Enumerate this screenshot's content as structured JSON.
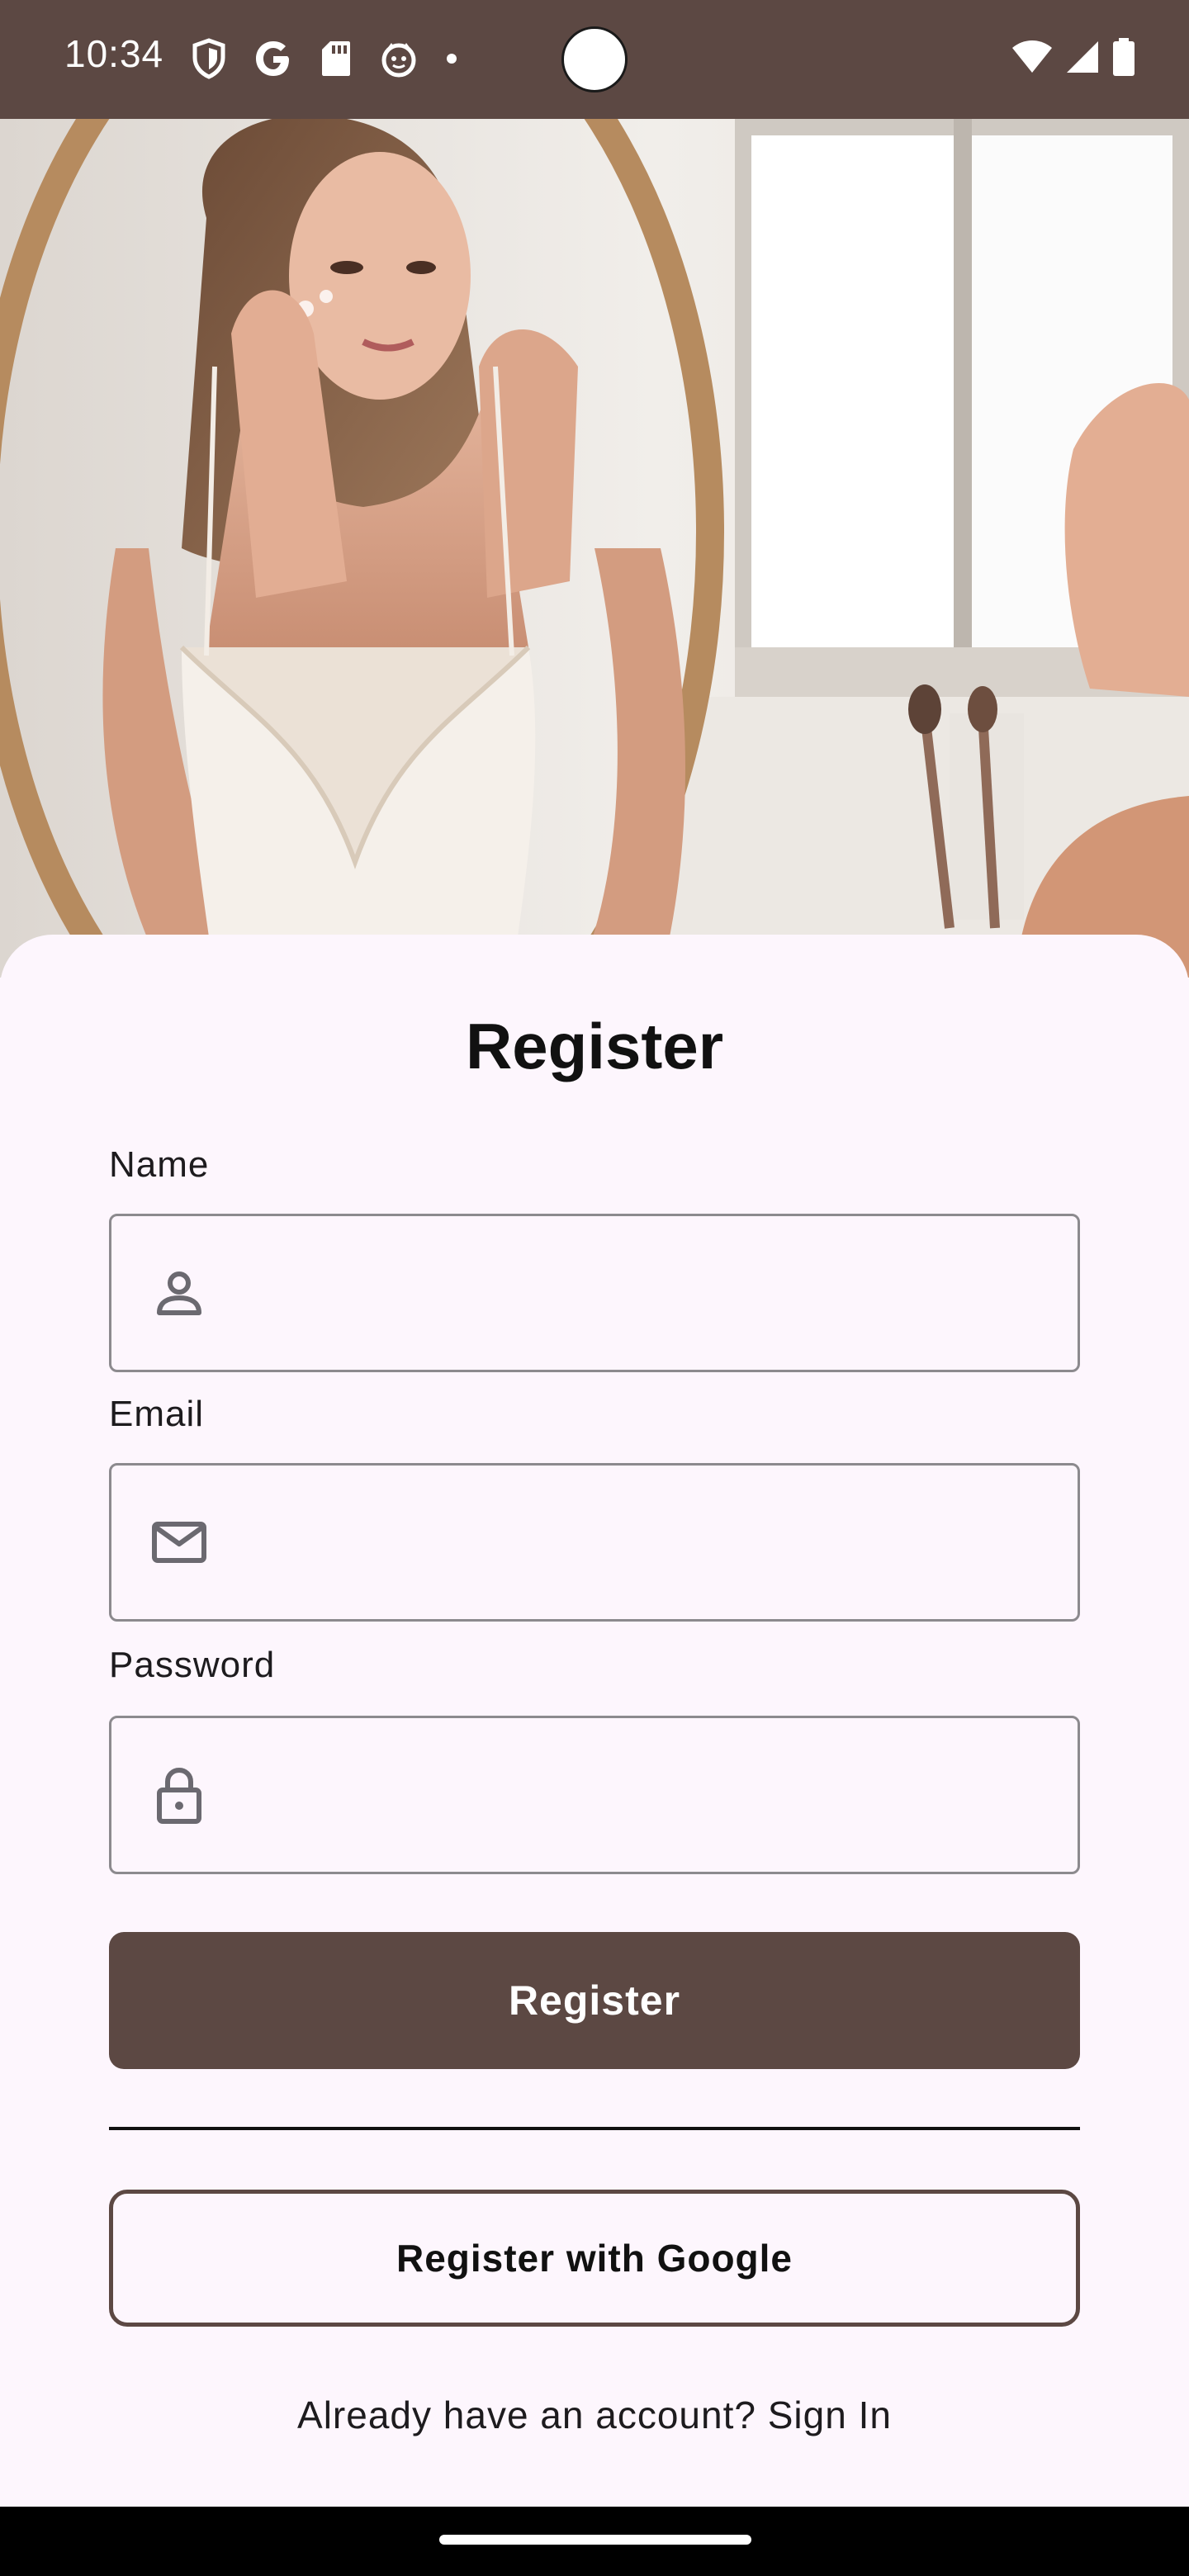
{
  "status_bar": {
    "time": "10:34",
    "icons_left": [
      "shield-icon",
      "google-g-icon",
      "sd-card-icon",
      "face-icon",
      "dot-icon"
    ],
    "icons_right": [
      "wifi-icon",
      "signal-icon",
      "battery-icon"
    ]
  },
  "hero": {
    "image_name": "woman-skincare-mirror-photo"
  },
  "form": {
    "title": "Register",
    "name_label": "Name",
    "name_value": "",
    "email_label": "Email",
    "email_value": "",
    "password_label": "Password",
    "password_value": "",
    "register_button": "Register",
    "google_button": "Register with Google",
    "signin_prompt": "Already have an account? Sign In"
  },
  "colors": {
    "primary": "#5c4843",
    "background": "#fdf6fd",
    "field_border": "#8c8a8e",
    "icon": "#6b6970"
  }
}
